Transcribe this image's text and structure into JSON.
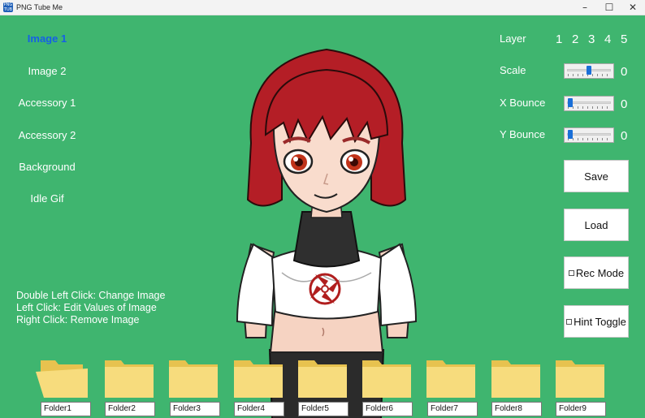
{
  "window": {
    "title": "PNG Tube Me",
    "icon_text": "PNG TUB"
  },
  "nav": {
    "items": [
      {
        "label": "Image 1",
        "active": true
      },
      {
        "label": "Image 2"
      },
      {
        "label": "Accessory 1"
      },
      {
        "label": "Accessory 2"
      },
      {
        "label": "Background"
      },
      {
        "label": "Idle Gif"
      }
    ]
  },
  "hints": [
    "Double Left Click: Change Image",
    "Left Click: Edit Values of Image",
    "Right Click: Remove Image"
  ],
  "layer": {
    "label": "Layer",
    "numbers": [
      "1",
      "2",
      "3",
      "4",
      "5"
    ]
  },
  "sliders": [
    {
      "label": "Scale",
      "value": "0",
      "level": 0.5
    },
    {
      "label": "X Bounce",
      "value": "0",
      "level": 0.0
    },
    {
      "label": "Y Bounce",
      "value": "0",
      "level": 0.0
    }
  ],
  "buttons": {
    "save": "Save",
    "load": "Load",
    "rec_mode": "Rec Mode",
    "hint_toggle": "Hint Toggle"
  },
  "folders": [
    "Folder1",
    "Folder2",
    "Folder3",
    "Folder4",
    "Folder5",
    "Folder6",
    "Folder7",
    "Folder8",
    "Folder9"
  ],
  "colors": {
    "background": "#3fb56f",
    "active_nav": "#1560e6",
    "folder": "#f7dc7d",
    "hair": "#b41e26"
  }
}
